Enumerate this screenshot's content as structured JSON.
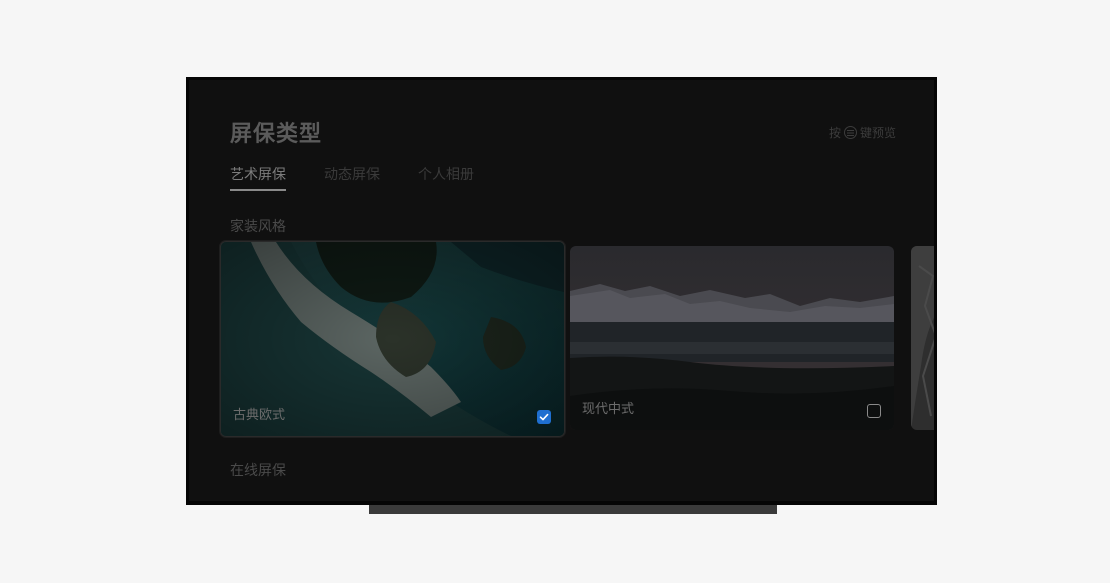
{
  "screen": {
    "title": "屏保类型",
    "hint": {
      "prefix": "按",
      "icon": "menu-icon",
      "suffix": "键预览"
    },
    "tabs": [
      {
        "label": "艺术屏保",
        "active": true
      },
      {
        "label": "动态屏保",
        "active": false
      },
      {
        "label": "个人相册",
        "active": false
      }
    ],
    "section_home_style": "家装风格",
    "cards": [
      {
        "label": "古典欧式",
        "checked": true,
        "image": "aerial-beach-photo"
      },
      {
        "label": "现代中式",
        "checked": false,
        "image": "mountain-lake-photo"
      },
      {
        "label": "",
        "checked": false,
        "image": "partial-rock-photo"
      }
    ],
    "section_online": "在线屏保"
  },
  "colors": {
    "accent_check": "#1f6fd0",
    "page_background": "#f6f6f6",
    "screen_background": "#101010"
  }
}
